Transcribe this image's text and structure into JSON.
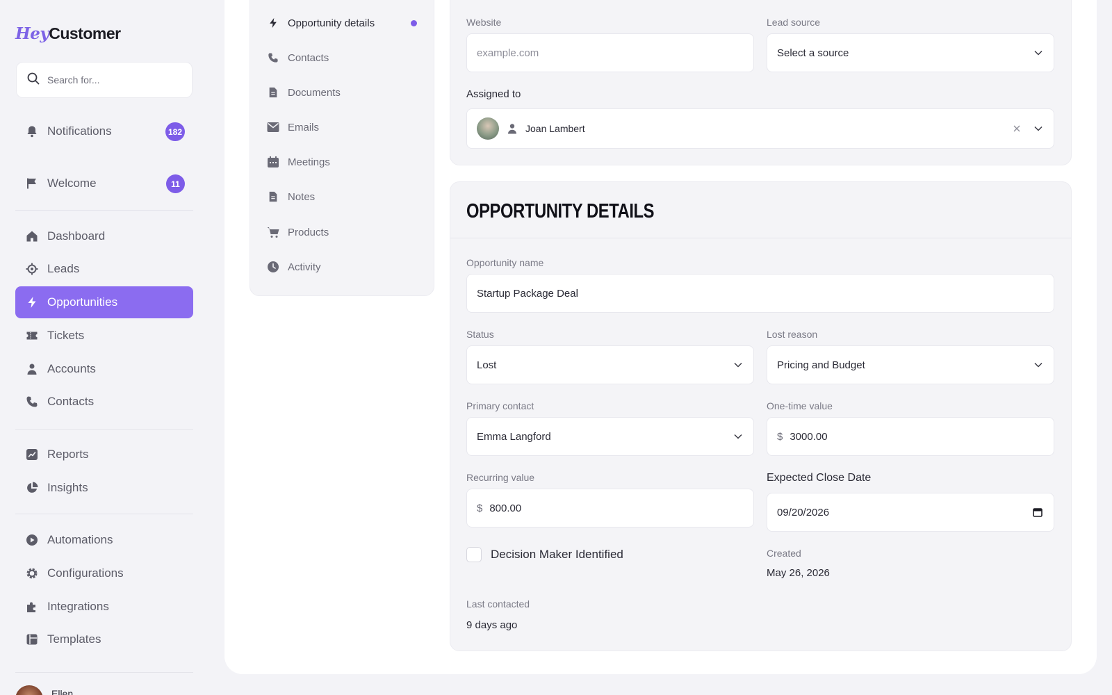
{
  "brand": {
    "logo_hey": "Hey",
    "logo_customer": "Customer"
  },
  "search": {
    "placeholder": "Search for..."
  },
  "sidebar": {
    "top_items": [
      {
        "label": "Notifications",
        "badge": "182"
      },
      {
        "label": "Welcome",
        "badge": "11"
      }
    ],
    "main_items": [
      {
        "label": "Dashboard"
      },
      {
        "label": "Leads"
      },
      {
        "label": "Opportunities"
      },
      {
        "label": "Tickets"
      },
      {
        "label": "Accounts"
      },
      {
        "label": "Contacts"
      }
    ],
    "report_items": [
      {
        "label": "Reports"
      },
      {
        "label": "Insights"
      }
    ],
    "config_items": [
      {
        "label": "Automations"
      },
      {
        "label": "Configurations"
      },
      {
        "label": "Integrations"
      },
      {
        "label": "Templates"
      }
    ],
    "user": {
      "name": "Ellen"
    }
  },
  "subnav": {
    "items": [
      {
        "label": "Opportunity details"
      },
      {
        "label": "Contacts"
      },
      {
        "label": "Documents"
      },
      {
        "label": "Emails"
      },
      {
        "label": "Meetings"
      },
      {
        "label": "Notes"
      },
      {
        "label": "Products"
      },
      {
        "label": "Activity"
      }
    ]
  },
  "account_card": {
    "website_label": "Website",
    "website_placeholder": "example.com",
    "lead_source_label": "Lead source",
    "lead_source_value": "Select a source",
    "assigned_label": "Assigned to",
    "assigned_value": "Joan Lambert"
  },
  "details": {
    "title": "OPPORTUNITY DETAILS",
    "name_label": "Opportunity name",
    "name_value": "Startup Package Deal",
    "status_label": "Status",
    "status_value": "Lost",
    "lost_reason_label": "Lost reason",
    "lost_reason_value": "Pricing and Budget",
    "primary_contact_label": "Primary contact",
    "primary_contact_value": "Emma Langford",
    "one_time_label": "One-time value",
    "one_time_value": "3000.00",
    "recurring_label": "Recurring value",
    "recurring_value": "800.00",
    "currency_symbol": "$",
    "close_date_label": "Expected Close Date",
    "close_date_value": "09/20/2026",
    "decision_maker_label": "Decision Maker Identified",
    "decision_maker_checked": false,
    "created_label": "Created",
    "created_value": "May 26, 2026",
    "last_contacted_label": "Last contacted",
    "last_contacted_value": "9 days ago"
  },
  "colors": {
    "accent": "#8b6cf0",
    "badge": "#7d5ce8",
    "background": "#f3f3f7"
  }
}
